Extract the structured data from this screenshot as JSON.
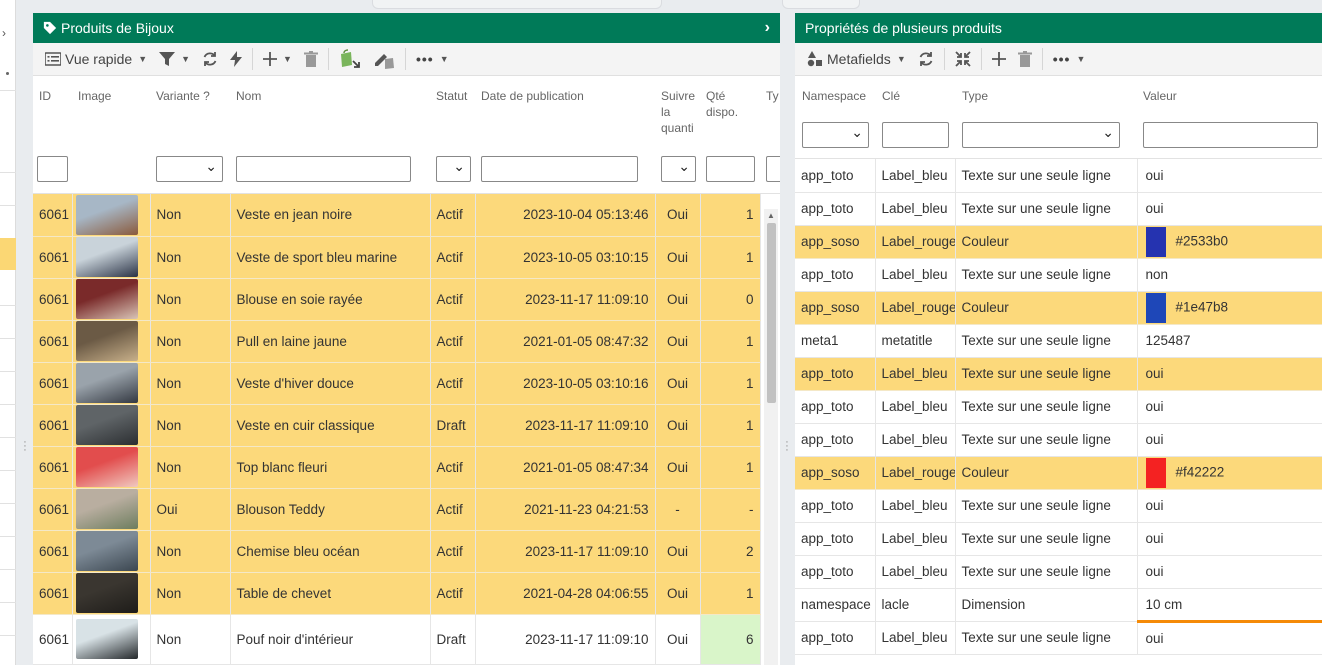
{
  "left_panel": {
    "title": "Produits de Bijoux",
    "toolbar": {
      "view_label": "Vue rapide"
    },
    "columns": [
      "ID",
      "Image",
      "Variante ?",
      "Nom",
      "Statut",
      "Date de publication",
      "Suivre la quanti",
      "Qté dispo.",
      "Ty"
    ],
    "rows": [
      {
        "id": "6061",
        "variant": "Non",
        "name": "Veste en jean noire",
        "status": "Actif",
        "date": "2023-10-04 05:13:46",
        "track": "Oui",
        "qty": "1",
        "img": [
          "#a7b7c6",
          "#8a5a3c"
        ]
      },
      {
        "id": "6061",
        "variant": "Non",
        "name": "Veste de sport bleu marine",
        "status": "Actif",
        "date": "2023-10-05 03:10:15",
        "track": "Oui",
        "qty": "1",
        "img": [
          "#c9d3da",
          "#2a3245"
        ]
      },
      {
        "id": "6061",
        "variant": "Non",
        "name": "Blouse en soie rayée",
        "status": "Actif",
        "date": "2023-11-17 11:09:10",
        "track": "Oui",
        "qty": "0",
        "img": [
          "#7a2a2a",
          "#d9c4b6"
        ]
      },
      {
        "id": "6061",
        "variant": "Non",
        "name": "Pull en laine jaune",
        "status": "Actif",
        "date": "2021-01-05 08:47:32",
        "track": "Oui",
        "qty": "1",
        "img": [
          "#6b5a45",
          "#c8b08a"
        ]
      },
      {
        "id": "6061",
        "variant": "Non",
        "name": "Veste d'hiver douce",
        "status": "Actif",
        "date": "2023-10-05 03:10:16",
        "track": "Oui",
        "qty": "1",
        "img": [
          "#9aa3ab",
          "#333841"
        ]
      },
      {
        "id": "6061",
        "variant": "Non",
        "name": "Veste en cuir classique",
        "status": "Draft",
        "date": "2023-11-17 11:09:10",
        "track": "Oui",
        "qty": "1",
        "img": [
          "#5f6467",
          "#2b2e31"
        ]
      },
      {
        "id": "6061",
        "variant": "Non",
        "name": "Top blanc fleuri",
        "status": "Actif",
        "date": "2021-01-05 08:47:34",
        "track": "Oui",
        "qty": "1",
        "img": [
          "#e24d4d",
          "#f0c9c0"
        ]
      },
      {
        "id": "6061",
        "variant": "Oui",
        "name": "Blouson Teddy",
        "status": "Actif",
        "date": "2021-11-23 04:21:53",
        "track": "-",
        "qty": "-",
        "img": [
          "#b9aea0",
          "#6d7d5e"
        ]
      },
      {
        "id": "6061",
        "variant": "Non",
        "name": "Chemise bleu océan",
        "status": "Actif",
        "date": "2023-11-17 11:09:10",
        "track": "Oui",
        "qty": "2",
        "img": [
          "#7d8a96",
          "#3b4650"
        ]
      },
      {
        "id": "6061",
        "variant": "Non",
        "name": "Table de chevet",
        "status": "Actif",
        "date": "2021-04-28 04:06:55",
        "track": "Oui",
        "qty": "1",
        "img": [
          "#3a3630",
          "#1e1c19"
        ]
      },
      {
        "id": "6061",
        "variant": "Non",
        "name": "Pouf noir d'intérieur",
        "status": "Draft",
        "date": "2023-11-17 11:09:10",
        "track": "Oui",
        "qty": "6",
        "img": [
          "#d8e2e6",
          "#23272a"
        ]
      }
    ]
  },
  "right_panel": {
    "title": "Propriétés de plusieurs produits",
    "toolbar": {
      "view_label": "Metafields"
    },
    "columns": [
      "Namespace",
      "Clé",
      "Type",
      "Valeur"
    ],
    "rows": [
      {
        "ns": "app_toto",
        "key": "Label_bleu",
        "type": "Texte sur une seule ligne",
        "value": "oui"
      },
      {
        "ns": "app_toto",
        "key": "Label_bleu",
        "type": "Texte sur une seule ligne",
        "value": "oui"
      },
      {
        "ns": "app_soso",
        "key": "Label_rouge",
        "type": "Couleur",
        "value": "#2533b0",
        "color": "#2533b0"
      },
      {
        "ns": "app_toto",
        "key": "Label_bleu",
        "type": "Texte sur une seule ligne",
        "value": "non"
      },
      {
        "ns": "app_soso",
        "key": "Label_rouge",
        "type": "Couleur",
        "value": "#1e47b8",
        "color": "#1e47b8"
      },
      {
        "ns": "meta1",
        "key": "metatitle",
        "type": "Texte sur une seule ligne",
        "value": "125487"
      },
      {
        "ns": "app_toto",
        "key": "Label_bleu",
        "type": "Texte sur une seule ligne",
        "value": "oui"
      },
      {
        "ns": "app_toto",
        "key": "Label_bleu",
        "type": "Texte sur une seule ligne",
        "value": "oui"
      },
      {
        "ns": "app_toto",
        "key": "Label_bleu",
        "type": "Texte sur une seule ligne",
        "value": "oui"
      },
      {
        "ns": "app_soso",
        "key": "Label_rouge",
        "type": "Couleur",
        "value": "#f42222",
        "color": "#f42222"
      },
      {
        "ns": "app_toto",
        "key": "Label_bleu",
        "type": "Texte sur une seule ligne",
        "value": "oui"
      },
      {
        "ns": "app_toto",
        "key": "Label_bleu",
        "type": "Texte sur une seule ligne",
        "value": "oui"
      },
      {
        "ns": "app_toto",
        "key": "Label_bleu",
        "type": "Texte sur une seule ligne",
        "value": "oui"
      },
      {
        "ns": "namespace",
        "key": "lacle",
        "type": "Dimension",
        "value": "10 cm"
      },
      {
        "ns": "app_toto",
        "key": "Label_bleu",
        "type": "Texte sur une seule ligne",
        "value": "oui"
      }
    ]
  },
  "colors": {
    "header_green": "#007a58",
    "selection": "#fcd97b",
    "focus_orange": "#f58a07",
    "qty_highlight": "#d9f5c9"
  }
}
